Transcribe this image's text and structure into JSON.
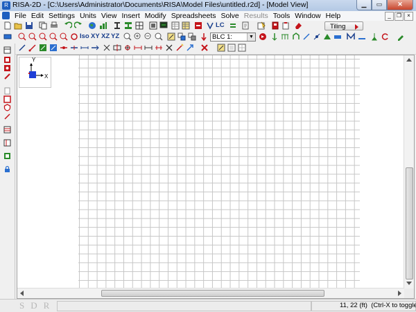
{
  "window": {
    "title": "RISA-2D - [C:\\Users\\Administrator\\Documents\\RISA\\Model Files\\untitled.r2d] - [Model View]"
  },
  "menu": [
    {
      "label": "File",
      "enabled": true
    },
    {
      "label": "Edit",
      "enabled": true
    },
    {
      "label": "Settings",
      "enabled": true
    },
    {
      "label": "Units",
      "enabled": true
    },
    {
      "label": "View",
      "enabled": true
    },
    {
      "label": "Insert",
      "enabled": true
    },
    {
      "label": "Modify",
      "enabled": true
    },
    {
      "label": "Spreadsheets",
      "enabled": true
    },
    {
      "label": "Solve",
      "enabled": true
    },
    {
      "label": "Results",
      "enabled": false
    },
    {
      "label": "Tools",
      "enabled": true
    },
    {
      "label": "Window",
      "enabled": true
    },
    {
      "label": "Help",
      "enabled": true
    }
  ],
  "toolbar1": {
    "lc_label": "LC",
    "tiling_label": "Tiling"
  },
  "toolbar2": {
    "iso_label": "Iso",
    "xy_label": "XY",
    "xz_label": "XZ",
    "yz_label": "YZ",
    "blc_value": "BLC 1:"
  },
  "axes": {
    "y_label": "Y",
    "x_label": "X"
  },
  "status": {
    "sdr_label": "SDR",
    "coords": "11, 22 (ft)",
    "toggle_hint": "(Ctrl-X to toggle)"
  },
  "colors": {
    "accent_blue": "#1f5fbf",
    "accent_red": "#c4141a",
    "accent_green": "#2a8a2a",
    "grid_line": "#c6c6c6"
  }
}
